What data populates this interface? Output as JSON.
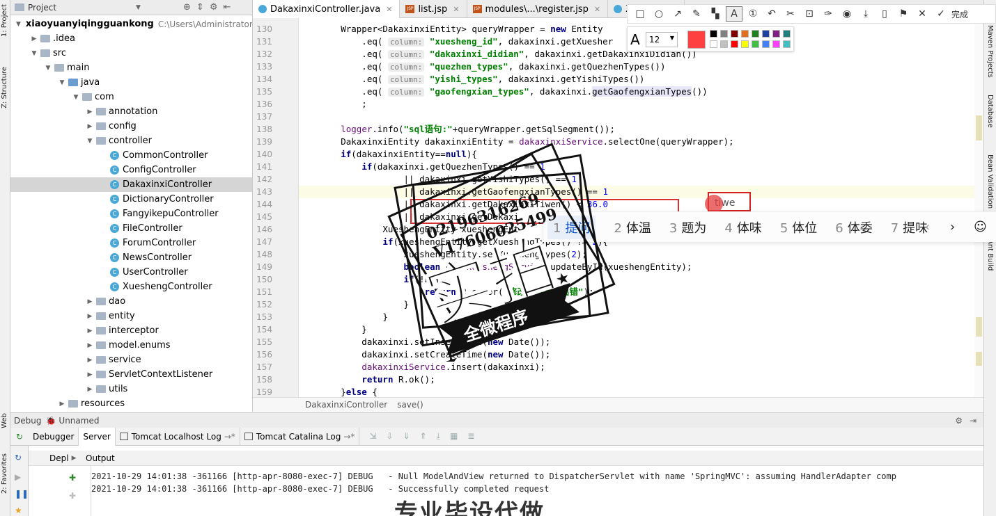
{
  "left_strip": {
    "project": "1: Project",
    "structure": "Z: Structure",
    "web": "Web",
    "favorites": "2: Favorites"
  },
  "right_strip": {
    "maven": "Maven Projects",
    "database": "Database",
    "bean": "Bean Validation",
    "ant": "Ant Build"
  },
  "project_panel": {
    "title": "Project",
    "tree": [
      {
        "label": "xiaoyuanyiqingguankong",
        "path": "C:\\Users\\Administrator\\D",
        "depth": 0,
        "open": true,
        "kind": "module"
      },
      {
        "label": ".idea",
        "depth": 1,
        "open": false,
        "kind": "folder"
      },
      {
        "label": "src",
        "depth": 1,
        "open": true,
        "kind": "folder"
      },
      {
        "label": "main",
        "depth": 2,
        "open": true,
        "kind": "folder"
      },
      {
        "label": "java",
        "depth": 3,
        "open": true,
        "kind": "src"
      },
      {
        "label": "com",
        "depth": 4,
        "open": true,
        "kind": "folder"
      },
      {
        "label": "annotation",
        "depth": 5,
        "open": false,
        "kind": "folder"
      },
      {
        "label": "config",
        "depth": 5,
        "open": false,
        "kind": "folder"
      },
      {
        "label": "controller",
        "depth": 5,
        "open": true,
        "kind": "folder"
      },
      {
        "label": "CommonController",
        "depth": 6,
        "kind": "class"
      },
      {
        "label": "ConfigController",
        "depth": 6,
        "kind": "class"
      },
      {
        "label": "DakaxinxiController",
        "depth": 6,
        "kind": "class",
        "selected": true
      },
      {
        "label": "DictionaryController",
        "depth": 6,
        "kind": "class"
      },
      {
        "label": "FangyikepuController",
        "depth": 6,
        "kind": "class"
      },
      {
        "label": "FileController",
        "depth": 6,
        "kind": "class"
      },
      {
        "label": "ForumController",
        "depth": 6,
        "kind": "class"
      },
      {
        "label": "NewsController",
        "depth": 6,
        "kind": "class"
      },
      {
        "label": "UserController",
        "depth": 6,
        "kind": "class"
      },
      {
        "label": "XueshengController",
        "depth": 6,
        "kind": "class"
      },
      {
        "label": "dao",
        "depth": 5,
        "open": false,
        "kind": "folder"
      },
      {
        "label": "entity",
        "depth": 5,
        "open": false,
        "kind": "folder"
      },
      {
        "label": "interceptor",
        "depth": 5,
        "open": false,
        "kind": "folder"
      },
      {
        "label": "model.enums",
        "depth": 5,
        "open": false,
        "kind": "folder"
      },
      {
        "label": "service",
        "depth": 5,
        "open": false,
        "kind": "folder"
      },
      {
        "label": "ServletContextListener",
        "depth": 5,
        "open": false,
        "kind": "folder"
      },
      {
        "label": "utils",
        "depth": 5,
        "open": false,
        "kind": "folder"
      },
      {
        "label": "resources",
        "depth": 3,
        "open": false,
        "kind": "folder"
      }
    ]
  },
  "editor_tabs": [
    {
      "label": "DakaxinxiController.java",
      "kind": "class",
      "active": true
    },
    {
      "label": "list.jsp",
      "kind": "jsp"
    },
    {
      "label": "modules\\...\\register.jsp",
      "kind": "jsp"
    },
    {
      "label": "Xueshen",
      "kind": "class"
    }
  ],
  "code_lines": [
    {
      "n": "130",
      "html": "        Wrapper&lt;DakaxinxiEntity&gt; queryWrapper = <span class='kw'>new</span> Entity"
    },
    {
      "n": "131",
      "html": "            .eq( <span class='hint'>column:</span> <span class='str'>\"xuesheng_id\"</span>, dakaxinxi.getXuesher"
    },
    {
      "n": "132",
      "html": "            .eq( <span class='hint'>column:</span> <span class='str'>\"dakaxinxi_didian\"</span>, dakaxinxi.getDakaxinxiDidian())"
    },
    {
      "n": "133",
      "html": "            .eq( <span class='hint'>column:</span> <span class='str'>\"quezhen_types\"</span>, dakaxinxi.getQuezhenTypes())"
    },
    {
      "n": "134",
      "html": "            .eq( <span class='hint'>column:</span> <span class='str'>\"yishi_types\"</span>, dakaxinxi.getYishiTypes())"
    },
    {
      "n": "135",
      "html": "            .eq( <span class='hint'>column:</span> <span class='str'>\"gaofengxian_types\"</span>, dakaxinxi.<span class='fhl'>getGaofengxianTypes</span>())"
    },
    {
      "n": "136",
      "html": "            ;"
    },
    {
      "n": "137",
      "html": ""
    },
    {
      "n": "138",
      "html": "        <span class='fld'>logger</span>.info(<span class='str'>\"sql语句:\"</span>+queryWrapper.getSqlSegment());"
    },
    {
      "n": "139",
      "html": "        DakaxinxiEntity dakaxinxiEntity = <span class='fld'>dakaxinxiService</span>.selectOne(queryWrapper);"
    },
    {
      "n": "140",
      "html": "        <span class='kw'>if</span>(dakaxinxiEntity==<span class='kw'>null</span>){"
    },
    {
      "n": "141",
      "html": "            <span class='kw'>if</span>(dakaxinxi.getQuezhenTypes() == <span style='color:#0000ff'>1</span>"
    },
    {
      "n": "142",
      "html": "                    || dakaxinxi.getYishiTypes() == <span style='color:#0000ff'>1</span>"
    },
    {
      "n": "143",
      "html": "                    || dakaxinxi.getGaofengxianTypes() == <span style='color:#0000ff'>1</span>",
      "hl": true
    },
    {
      "n": "144",
      "html": "                    || dakaxinxi.getDakaxinxiTiwen() &lt; <span style='color:#0000ff'>36.0</span>"
    },
    {
      "n": "145",
      "html": "                    || dakaxinxi.getDakaxi"
    },
    {
      "n": "146",
      "html": "                XueshengEntity xueshengEnt"
    },
    {
      "n": "147",
      "html": "                <span class='kw'>if</span>(xueshengEntity.getXueshengTypes() != <span style='color:#0000ff'>2</span>){"
    },
    {
      "n": "148",
      "html": "                    xueshengEntity.setXueshengTypes(<span style='color:#0000ff'>2</span>);"
    },
    {
      "n": "149",
      "html": "                    <span class='kw'>boolean</span> b = <span class='fld'>xueshengService</span>.updateById(xueshengEntity);"
    },
    {
      "n": "150",
      "html": "                    <span class='kw'>if</span>(!b){"
    },
    {
      "n": "151",
      "html": "                        <span class='kw'>return</span> R.error(<span class='str'>\"修改学生状态出错\"</span>);"
    },
    {
      "n": "152",
      "html": "                    }"
    },
    {
      "n": "153",
      "html": "                }"
    },
    {
      "n": "154",
      "html": "            }"
    },
    {
      "n": "155",
      "html": "            dakaxinxi.setInsertTime(<span class='kw'>new</span> Date());"
    },
    {
      "n": "156",
      "html": "            dakaxinxi.setCreateTime(<span class='kw'>new</span> Date());"
    },
    {
      "n": "157",
      "html": "            <span class='fld'>dakaxinxiService</span>.insert(dakaxinxi);"
    },
    {
      "n": "158",
      "html": "            <span class='kw'>return</span> R.ok();"
    },
    {
      "n": "159",
      "html": "        }<span class='kw'>else</span> {"
    }
  ],
  "breadcrumb": {
    "cls": "DakaxinxiController",
    "method": "save()"
  },
  "debug": {
    "title": "Debug",
    "config": "Unnamed",
    "tabs": [
      "Debugger",
      "Server",
      "Tomcat Localhost Log",
      "Tomcat Catalina Log"
    ],
    "deploy": "Depl",
    "output": "Output",
    "log": [
      "2021-10-29 14:01:38 -361166 [http-apr-8080-exec-7] DEBUG   - Null ModelAndView returned to DispatcherServlet with name 'SpringMVC': assuming HandlerAdapter comp",
      "2021-10-29 14:01:38 -361166 [http-apr-8080-exec-7] DEBUG   - Successfully completed request"
    ]
  },
  "annotation_toolbar": {
    "finish": "完成",
    "font_size": "12",
    "colors": [
      "#ff4040",
      "#000000",
      "#808080",
      "#800000",
      "#e07020",
      "#208020",
      "#2040a0",
      "#802080",
      "#208080",
      "#ffffff",
      "#c0c0c0",
      "#ff0000",
      "#ffff00",
      "#40c040",
      "#4080ff",
      "#ff40ff",
      "#40c0c0"
    ]
  },
  "ime": {
    "composition": "tiwe",
    "candidates": [
      {
        "n": "1",
        "text": "提问"
      },
      {
        "n": "2",
        "text": "体温"
      },
      {
        "n": "3",
        "text": "题为"
      },
      {
        "n": "4",
        "text": "体味"
      },
      {
        "n": "5",
        "text": "体位"
      },
      {
        "n": "6",
        "text": "体委"
      },
      {
        "n": "7",
        "text": "提味"
      }
    ]
  },
  "watermark": {
    "phone1": "02196316269",
    "phone2": "V17606025499",
    "big": "实拍",
    "banner": "全微程序",
    "bottom": "专业毕设代做"
  }
}
